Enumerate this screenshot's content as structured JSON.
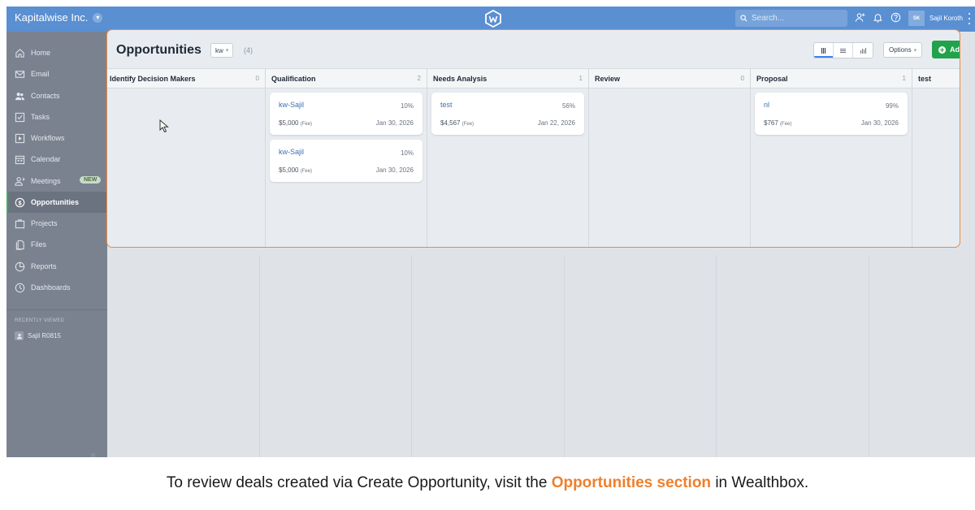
{
  "topbar": {
    "company": "Kapitalwise Inc.",
    "search_placeholder": "Search...",
    "user_initials": "SK",
    "user_name": "Sajil Koroth"
  },
  "sidebar": {
    "items": [
      {
        "label": "Home",
        "icon": "home-icon"
      },
      {
        "label": "Email",
        "icon": "mail-icon"
      },
      {
        "label": "Contacts",
        "icon": "contacts-icon"
      },
      {
        "label": "Tasks",
        "icon": "tasks-icon"
      },
      {
        "label": "Workflows",
        "icon": "workflows-icon"
      },
      {
        "label": "Calendar",
        "icon": "calendar-icon"
      },
      {
        "label": "Meetings",
        "icon": "meetings-icon",
        "badge": "NEW"
      },
      {
        "label": "Opportunities",
        "icon": "dollar-icon",
        "active": true
      },
      {
        "label": "Projects",
        "icon": "projects-icon"
      },
      {
        "label": "Files",
        "icon": "files-icon"
      },
      {
        "label": "Reports",
        "icon": "reports-icon"
      },
      {
        "label": "Dashboards",
        "icon": "dashboards-icon"
      }
    ],
    "recent_header": "RECENTLY VIEWED",
    "recent_items": [
      "Sajil R0815"
    ]
  },
  "opportunities": {
    "title": "Opportunities",
    "owner_filter": "kw",
    "count": "(4)",
    "options_label": "Options",
    "add_label": "Ad"
  },
  "board": {
    "columns": [
      {
        "name": "Identify Decision Makers",
        "count": "0",
        "cards": []
      },
      {
        "name": "Qualification",
        "count": "2",
        "cards": [
          {
            "name": "kw-Sajil",
            "pct": "10%",
            "amount": "$5,000",
            "fee": "(Fee)",
            "date": "Jan 30, 2026"
          },
          {
            "name": "kw-Sajil",
            "pct": "10%",
            "amount": "$5,000",
            "fee": "(Fee)",
            "date": "Jan 30, 2026"
          }
        ]
      },
      {
        "name": "Needs Analysis",
        "count": "1",
        "cards": [
          {
            "name": "test",
            "pct": "56%",
            "amount": "$4,567",
            "fee": "(Fee)",
            "date": "Jan 22, 2026"
          }
        ]
      },
      {
        "name": "Review",
        "count": "0",
        "cards": []
      },
      {
        "name": "Proposal",
        "count": "1",
        "cards": [
          {
            "name": "nl",
            "pct": "99%",
            "amount": "$767",
            "fee": "(Fee)",
            "date": "Jan 30, 2026"
          }
        ]
      },
      {
        "name": "test",
        "count": "",
        "cards": []
      }
    ]
  },
  "caption": {
    "before": "To review deals created via Create Opportunity, visit the ",
    "highlight": "Opportunities section",
    "after": " in Wealthbox."
  },
  "colors": {
    "topbar": "#5a8fd2",
    "sidebar": "#7a8290",
    "highlight_border": "#ef8a3a",
    "add_button": "#22a24b",
    "caption_highlight": "#ef7f2c",
    "card_link": "#3b6fb5"
  }
}
